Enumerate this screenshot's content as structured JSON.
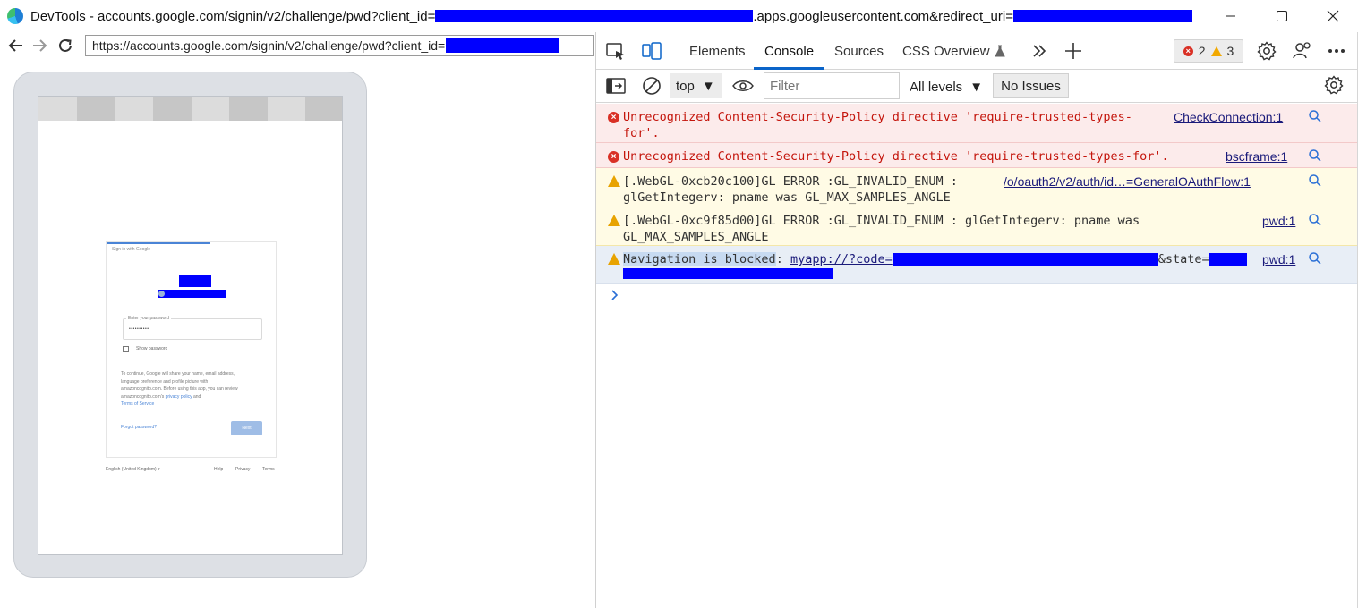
{
  "window": {
    "title_prefix": "DevTools - accounts.google.com/signin/v2/challenge/pwd?client_id=",
    "title_mid": ".apps.googleusercontent.com&redirect_uri="
  },
  "browser": {
    "url": "https://accounts.google.com/signin/v2/challenge/pwd?client_id="
  },
  "signin_page": {
    "header": "Sign in with Google",
    "password_label": "Enter your password",
    "password_dots": "••••••••••",
    "show_password": "Show password",
    "body_line1": "To continue, Google will share your name, email address,",
    "body_line2": "language preference and profile picture with",
    "body_line3": "amazoncognito.com. Before using this app, you can review",
    "body_line4": "amazoncognito.com's",
    "privacy_link": "privacy policy",
    "and": "and",
    "terms_link": "Terms of Service",
    "forgot": "Forgot password?",
    "next": "Next",
    "language": "English (United Kingdom)",
    "help": "Help",
    "privacy": "Privacy",
    "terms": "Terms"
  },
  "devtools": {
    "tabs": [
      "Elements",
      "Console",
      "Sources",
      "CSS Overview"
    ],
    "error_count": "2",
    "warning_count": "3",
    "context": "top",
    "filter_placeholder": "Filter",
    "levels": "All levels",
    "issues": "No Issues"
  },
  "console": [
    {
      "level": "error",
      "text": "Unrecognized Content-Security-Policy directive 'require-trusted-types-\nfor'.",
      "source": "CheckConnection:1"
    },
    {
      "level": "error",
      "text": "Unrecognized Content-Security-Policy directive 'require-trusted-types-for'.",
      "source": "bscframe:1"
    },
    {
      "level": "warning",
      "text": "[.WebGL-0xcb20c100]GL ERROR :GL_INVALID_ENUM :\nglGetIntegerv: pname was GL_MAX_SAMPLES_ANGLE",
      "source": "/o/oauth2/v2/auth/id…=GeneralOAuthFlow:1"
    },
    {
      "level": "warning",
      "text": "[.WebGL-0xc9f85d00]GL ERROR :GL_INVALID_ENUM : glGetIntegerv: pname was\nGL_MAX_SAMPLES_ANGLE",
      "source": "pwd:1"
    },
    {
      "level": "warning",
      "highlight": "Navigation is blocked",
      "after": ": ",
      "link_prefix": "myapp://?code=",
      "state": "&state=",
      "source": "pwd:1"
    }
  ],
  "colors": {
    "error_bg": "#fcebeb",
    "warning_bg": "#fffbe5",
    "selected_bg": "#e8eef6",
    "accent": "#0a64c9",
    "redaction": "#0000ff"
  }
}
